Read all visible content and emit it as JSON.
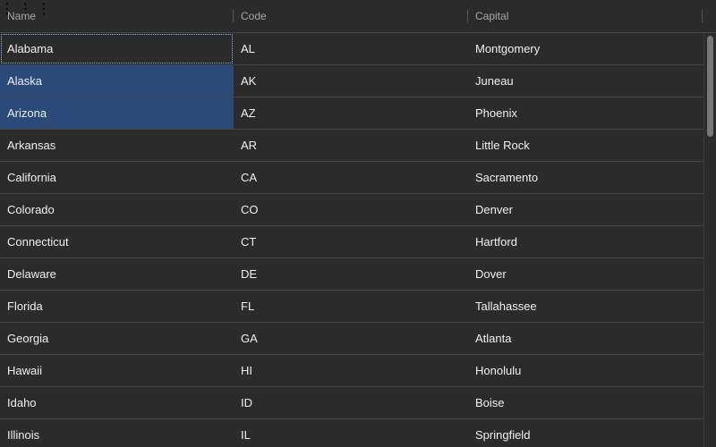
{
  "columns": {
    "name": "Name",
    "code": "Code",
    "capital": "Capital",
    "menu_icon": "more-vertical-icon"
  },
  "rows": [
    {
      "name": "Alabama",
      "code": "AL",
      "capital": "Montgomery"
    },
    {
      "name": "Alaska",
      "code": "AK",
      "capital": "Juneau"
    },
    {
      "name": "Arizona",
      "code": "AZ",
      "capital": "Phoenix"
    },
    {
      "name": "Arkansas",
      "code": "AR",
      "capital": "Little Rock"
    },
    {
      "name": "California",
      "code": "CA",
      "capital": "Sacramento"
    },
    {
      "name": "Colorado",
      "code": "CO",
      "capital": "Denver"
    },
    {
      "name": "Connecticut",
      "code": "CT",
      "capital": "Hartford"
    },
    {
      "name": "Delaware",
      "code": "DE",
      "capital": "Dover"
    },
    {
      "name": "Florida",
      "code": "FL",
      "capital": "Tallahassee"
    },
    {
      "name": "Georgia",
      "code": "GA",
      "capital": "Atlanta"
    },
    {
      "name": "Hawaii",
      "code": "HI",
      "capital": "Honolulu"
    },
    {
      "name": "Idaho",
      "code": "ID",
      "capital": "Boise"
    },
    {
      "name": "Illinois",
      "code": "IL",
      "capital": "Springfield"
    }
  ],
  "selection": {
    "focused_row": 0,
    "selected_name_rows": [
      1,
      2
    ]
  },
  "colors": {
    "background": "#2b2b2b",
    "selected": "#2b4a7a",
    "text": "#f0f0f0",
    "header_text": "#a8a8a8"
  }
}
